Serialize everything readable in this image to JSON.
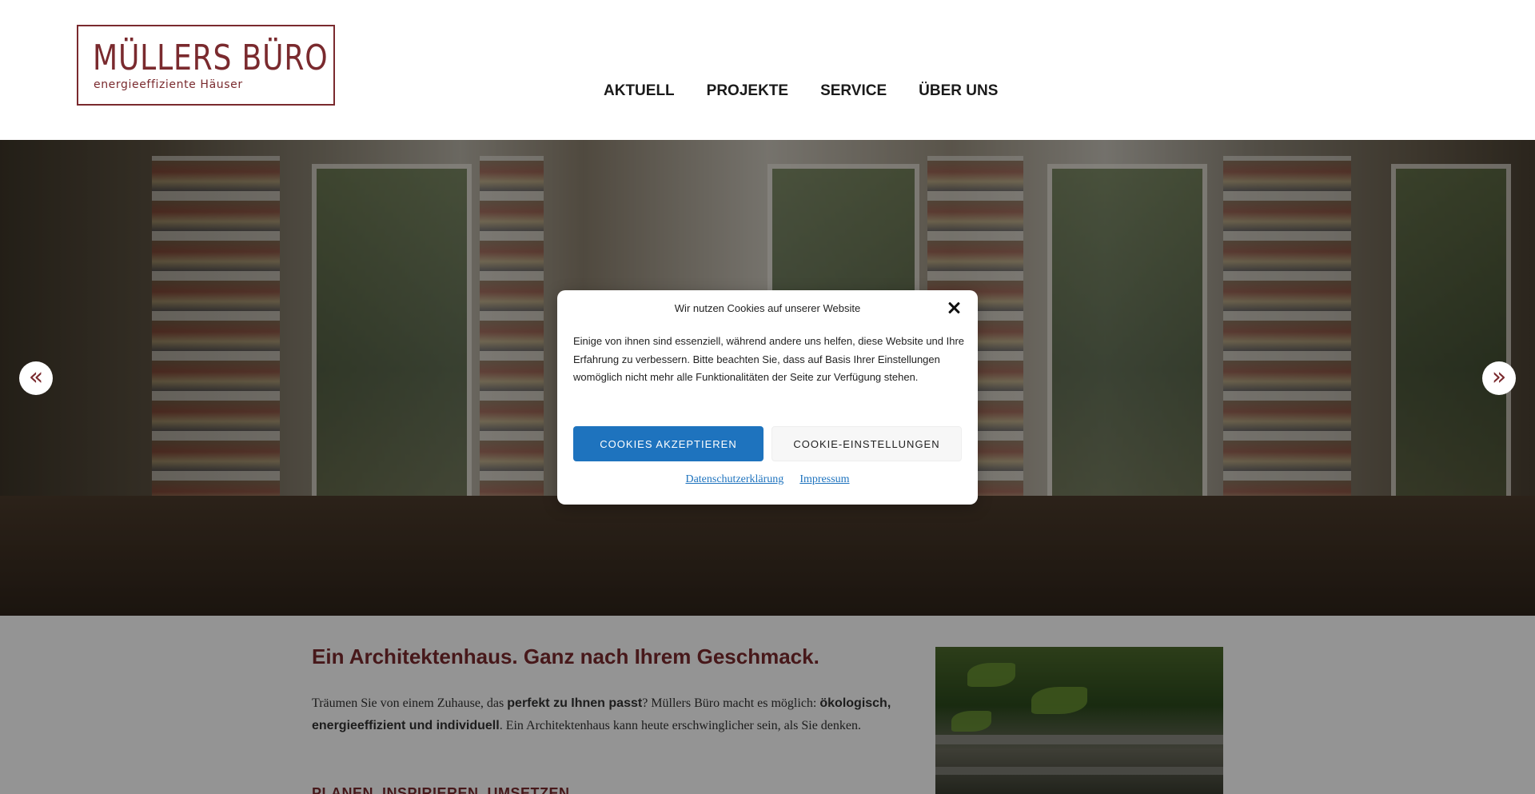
{
  "header": {
    "logo_title": "MÜLLERS BÜRO",
    "logo_subtitle": "energieeffiziente Häuser",
    "nav": [
      {
        "label": "AKTUELL"
      },
      {
        "label": "PROJEKTE"
      },
      {
        "label": "SERVICE"
      },
      {
        "label": "ÜBER UNS"
      }
    ]
  },
  "hero": {
    "prev_icon": "chevron-double-left-icon",
    "next_icon": "chevron-double-right-icon",
    "prev_glyph": "«",
    "next_glyph": "»"
  },
  "content": {
    "title": "Ein Architektenhaus. Ganz nach Ihrem Geschmack.",
    "text_1": "Träumen Sie von einem Zuhause, das ",
    "text_bold_1": "perfekt zu Ihnen passt",
    "text_2": "? Müllers Büro macht es möglich: ",
    "text_bold_2": "ökologisch, energieeffizient und individuell",
    "text_3": ". Ein Architektenhaus kann heute erschwinglicher sein, als Sie denken.",
    "subhead": "PLANEN. INSPIRIEREN. UMSETZEN."
  },
  "cookie_modal": {
    "title": "Wir nutzen Cookies auf unserer Website",
    "close_icon": "close-icon",
    "text": "Einige von ihnen sind essenziell, während andere uns helfen, diese Website und Ihre Erfahrung zu verbessern. Bitte beachten Sie, dass auf Basis Ihrer Einstellungen womöglich nicht mehr alle Funktionalitäten der Seite zur Verfügung stehen.",
    "accept_label": "COOKIES AKZEPTIEREN",
    "settings_label": "COOKIE-EINSTELLUNGEN",
    "link_privacy": "Datenschutzerklärung",
    "link_imprint": "Impressum"
  },
  "colors": {
    "brand": "#7a2a2e",
    "accept_button": "#1e73be",
    "link": "#1e73be"
  }
}
